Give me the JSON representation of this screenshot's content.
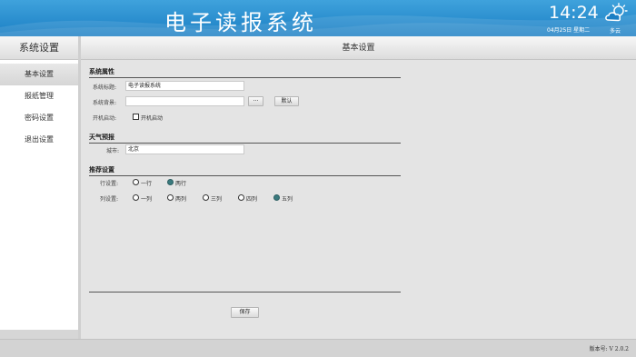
{
  "header": {
    "title": "电子读报系统",
    "time": "14:24",
    "date": "04月25日 星期二",
    "weather_icon": "partly-cloudy-icon",
    "weather": "多云",
    "colors": {
      "header_top": "#3fa2dc",
      "header_bottom": "#1b7fc4"
    }
  },
  "sidebar": {
    "title": "系统设置",
    "items": [
      {
        "label": "基本设置",
        "active": true
      },
      {
        "label": "报纸管理"
      },
      {
        "label": "密码设置"
      },
      {
        "label": "退出设置"
      }
    ]
  },
  "main": {
    "title": "基本设置",
    "system": {
      "section": "系统属性",
      "title_label": "系统标题:",
      "title_value": "电子读报系统",
      "bg_label": "系统背景:",
      "bg_value": "",
      "browse_label": "···",
      "default_label": "默认",
      "startup_label": "开机启动:",
      "startup_option": "开机启动",
      "startup_checked": false
    },
    "weather": {
      "section": "天气预报",
      "city_label": "城市:",
      "city_value": "北京"
    },
    "layout": {
      "section": "推荐设置",
      "row_label": "行设置:",
      "row_options": [
        "一行",
        "两行"
      ],
      "row_selected": "两行",
      "col_label": "列设置:",
      "col_options": [
        "一列",
        "两列",
        "三列",
        "四列",
        "五列"
      ],
      "col_selected": "五列"
    },
    "save_label": "保存",
    "radio_selected_color": "#3a7a7e"
  },
  "footer": {
    "version": "版本号: V 2.0.2"
  }
}
